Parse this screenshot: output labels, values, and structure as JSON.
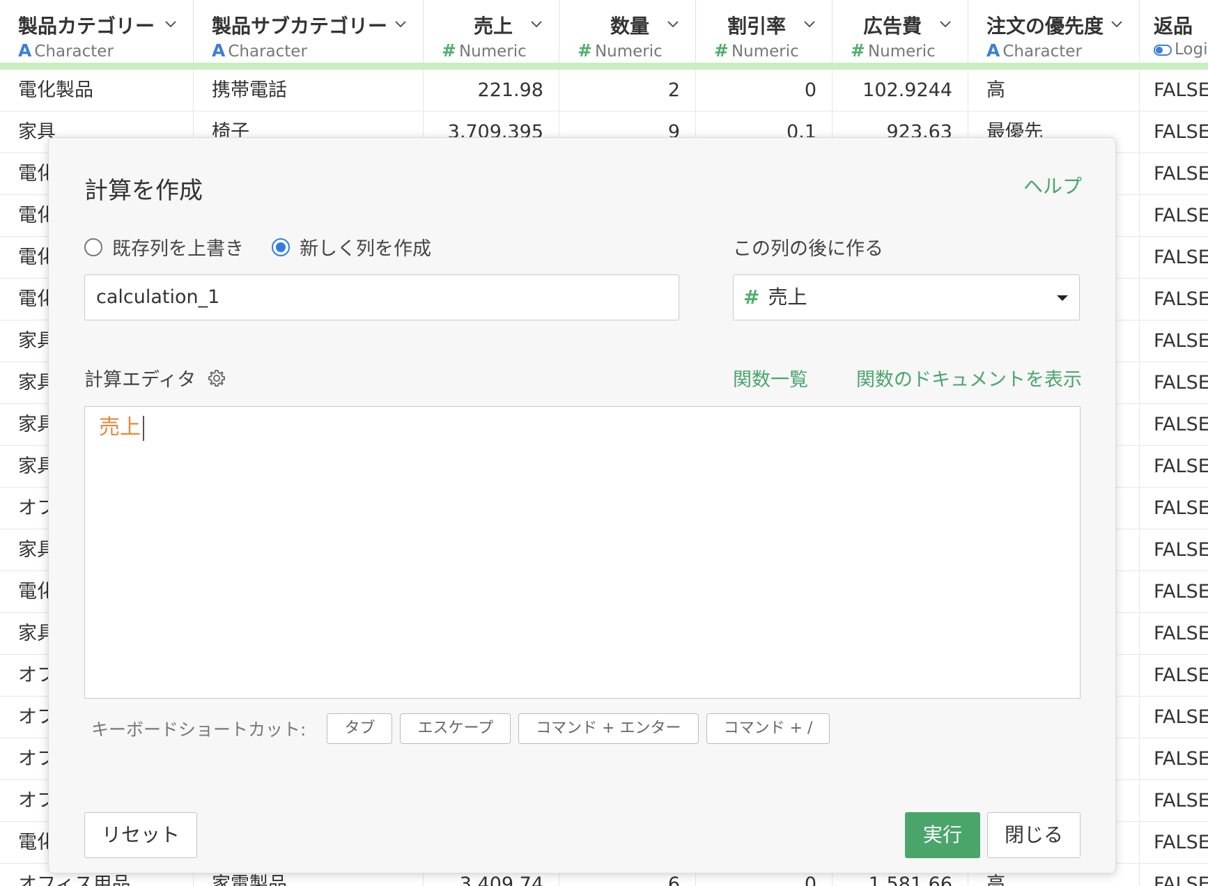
{
  "columns": [
    {
      "name": "製品カテゴリー",
      "type_icon": "A",
      "type": "Character"
    },
    {
      "name": "製品サブカテゴリー",
      "type_icon": "A",
      "type": "Character"
    },
    {
      "name": "売上",
      "type_icon": "#",
      "type": "Numeric"
    },
    {
      "name": "数量",
      "type_icon": "#",
      "type": "Numeric"
    },
    {
      "name": "割引率",
      "type_icon": "#",
      "type": "Numeric"
    },
    {
      "name": "広告費",
      "type_icon": "#",
      "type": "Numeric"
    },
    {
      "name": "注文の優先度",
      "type_icon": "A",
      "type": "Character"
    },
    {
      "name": "返品",
      "type_icon": "toggle",
      "type": "Logi"
    }
  ],
  "rows": [
    [
      "電化製品",
      "携帯電話",
      "221.98",
      "2",
      "0",
      "102.9244",
      "高",
      "FALSE"
    ],
    [
      "家具",
      "椅子",
      "3,709.395",
      "9",
      "0.1",
      "923.63",
      "最優先",
      "FALSE"
    ],
    [
      "電化",
      "",
      "",
      "",
      "",
      "",
      "",
      "FALSE"
    ],
    [
      "電化",
      "",
      "",
      "",
      "",
      "",
      "",
      "FALSE"
    ],
    [
      "電化",
      "",
      "",
      "",
      "",
      "",
      "",
      "FALSE"
    ],
    [
      "電化",
      "",
      "",
      "",
      "",
      "",
      "",
      "FALSE"
    ],
    [
      "家具",
      "",
      "",
      "",
      "",
      "",
      "",
      "FALSE"
    ],
    [
      "家具",
      "",
      "",
      "",
      "",
      "",
      "",
      "FALSE"
    ],
    [
      "家具",
      "",
      "",
      "",
      "",
      "",
      "",
      "FALSE"
    ],
    [
      "家具",
      "",
      "",
      "",
      "",
      "",
      "",
      "FALSE"
    ],
    [
      "オフ",
      "",
      "",
      "",
      "",
      "",
      "",
      "FALSE"
    ],
    [
      "家具",
      "",
      "",
      "",
      "",
      "",
      "",
      "FALSE"
    ],
    [
      "電化",
      "",
      "",
      "",
      "",
      "",
      "",
      "FALSE"
    ],
    [
      "家具",
      "",
      "",
      "",
      "",
      "",
      "",
      "FALSE"
    ],
    [
      "オフ",
      "",
      "",
      "",
      "",
      "",
      "",
      "FALSE"
    ],
    [
      "オフ",
      "",
      "",
      "",
      "",
      "",
      "",
      "FALSE"
    ],
    [
      "オフ",
      "",
      "",
      "",
      "",
      "",
      "",
      "FALSE"
    ],
    [
      "オフ",
      "",
      "",
      "",
      "",
      "",
      "",
      "FALSE"
    ],
    [
      "電化",
      "",
      "",
      "",
      "",
      "",
      "",
      "FALSE"
    ],
    [
      "オフィス用品",
      "家電製品",
      "3,409.74",
      "6",
      "0",
      "1,581.66",
      "高",
      "FALSE"
    ]
  ],
  "dialog": {
    "title": "計算を作成",
    "help_link": "ヘルプ",
    "radio_overwrite": "既存列を上書き",
    "radio_new": "新しく列を作成",
    "after_column_label": "この列の後に作る",
    "new_column_name": "calculation_1",
    "after_column_value": "売上",
    "editor_label": "計算エディタ",
    "function_list_link": "関数一覧",
    "function_doc_link": "関数のドキュメントを表示",
    "editor_content": "売上",
    "shortcuts_label": "キーボードショートカット:",
    "shortcut_keys": [
      "タブ",
      "エスケープ",
      "コマンド + エンター",
      "コマンド + /"
    ],
    "reset_button": "リセット",
    "run_button": "実行",
    "close_button": "閉じる"
  },
  "colors": {
    "accent_green": "#4aa56b",
    "header_bar": "#c8efc0",
    "character_icon": "#3c7fd6",
    "numeric_icon": "#4caf6a",
    "code_text": "#e58a3a",
    "radio_selected": "#2f7de1"
  }
}
